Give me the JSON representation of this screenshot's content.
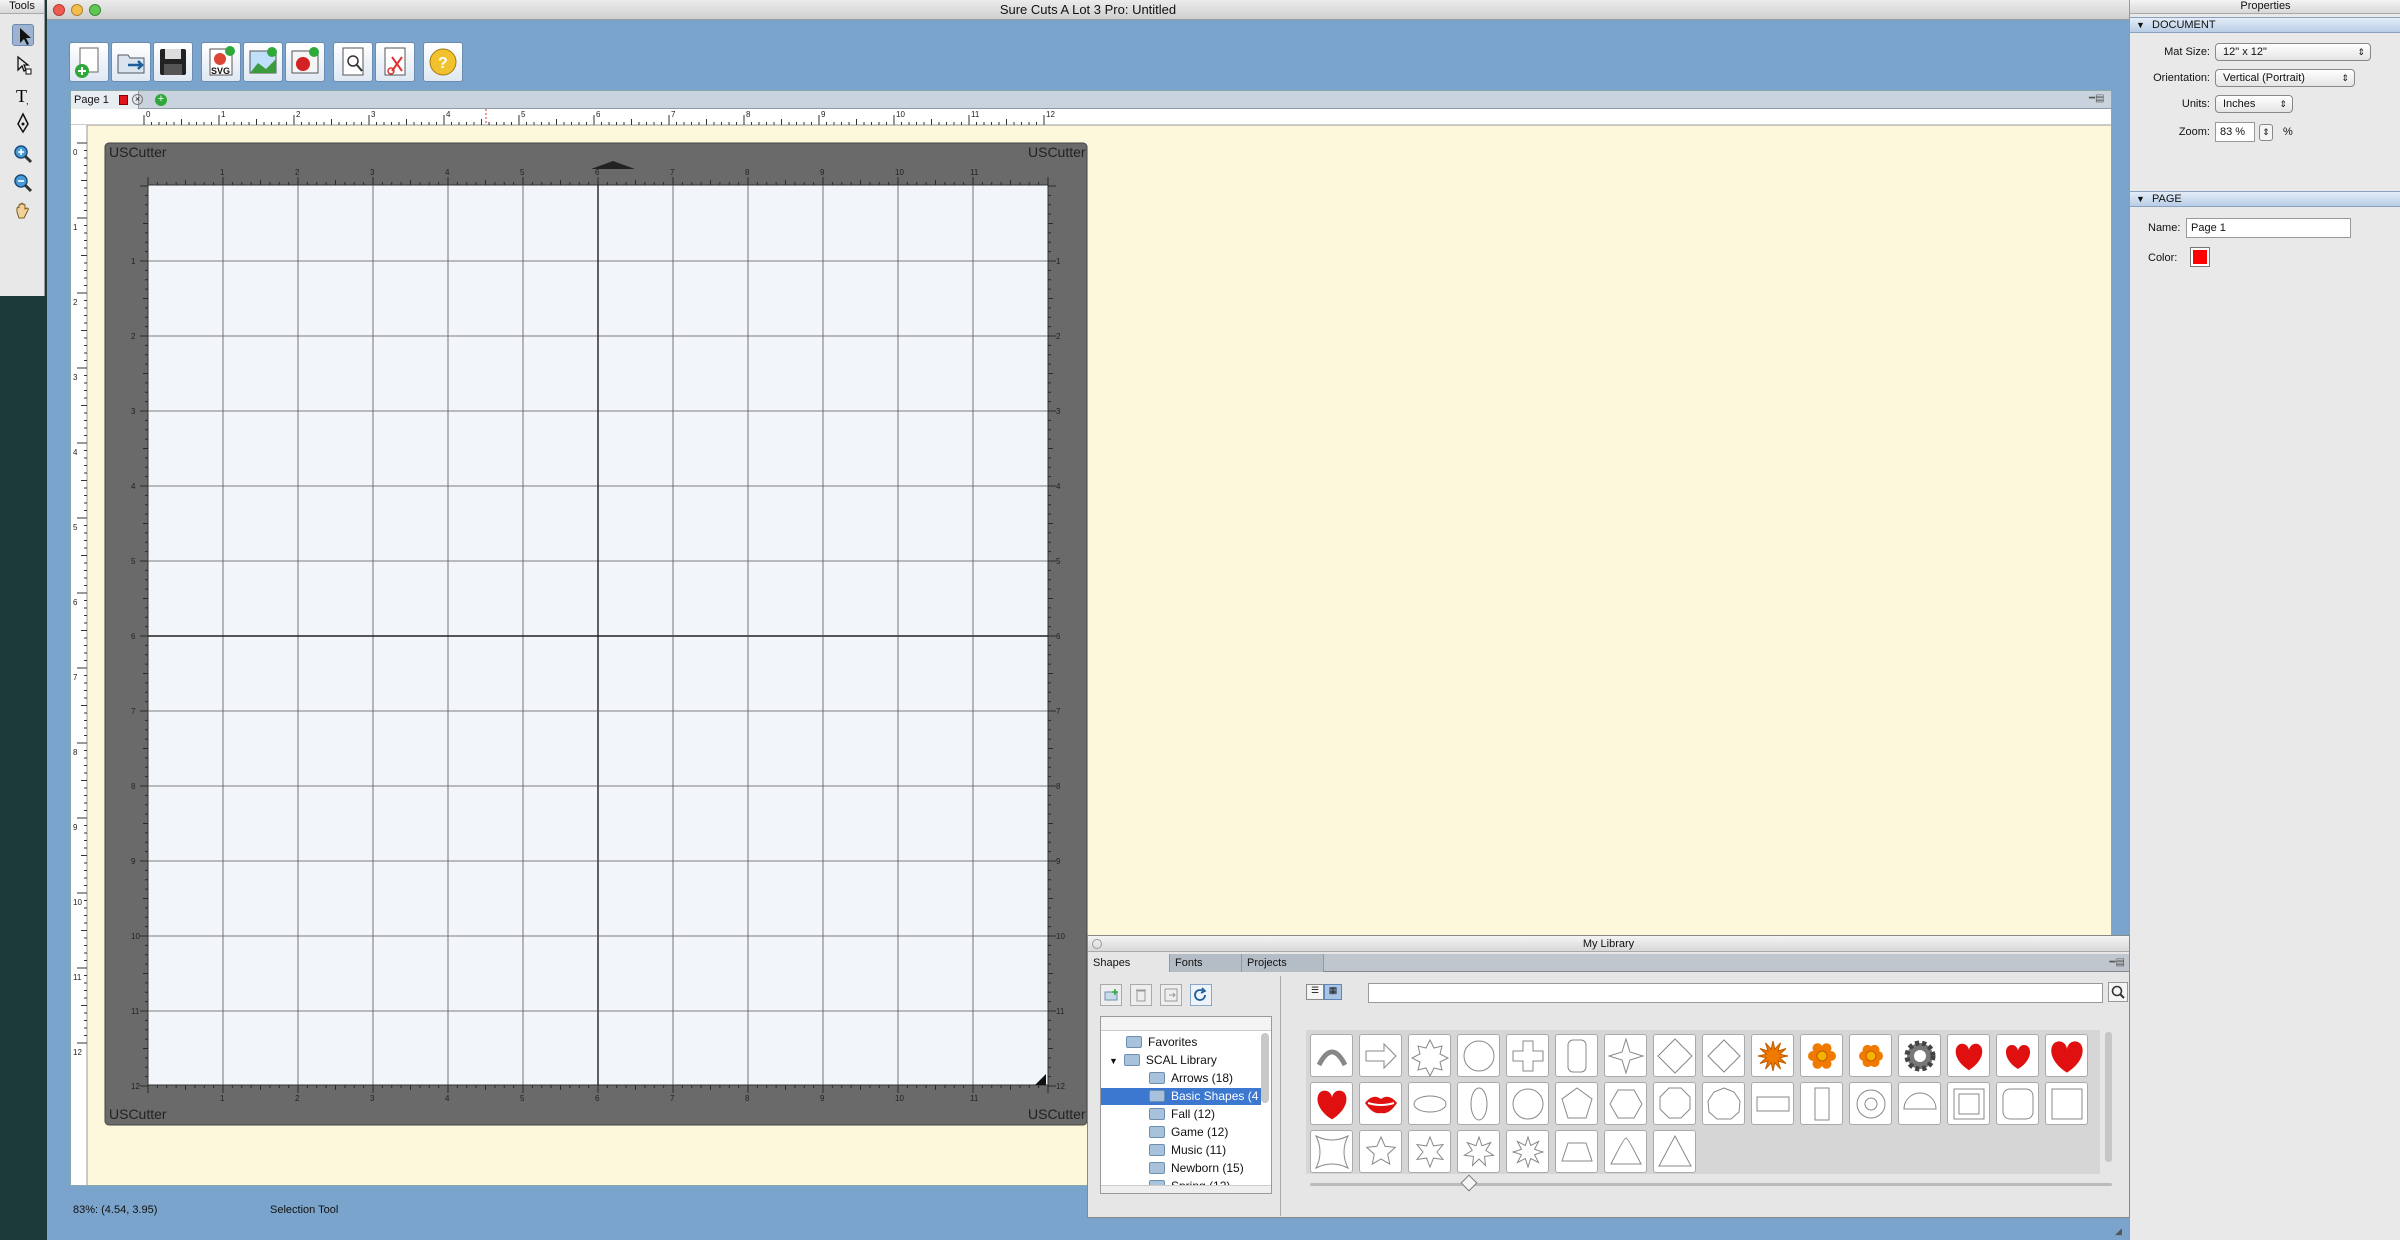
{
  "tools_palette": {
    "title": "Tools",
    "tools": [
      "selection-arrow-icon",
      "node-edit-icon",
      "text-tool-icon",
      "pen-tool-icon",
      "zoom-in-icon",
      "zoom-out-icon",
      "hand-pan-icon"
    ]
  },
  "window": {
    "title": "Sure Cuts A Lot 3 Pro: Untitled"
  },
  "toolbar": {
    "buttons": [
      "new-document-icon",
      "open-icon",
      "save-icon",
      "import-svg-icon",
      "import-image-icon",
      "trace-image-icon",
      "preview-icon",
      "cut-settings-icon",
      "help-icon"
    ]
  },
  "tabs": {
    "page_tab": "Page 1",
    "page_tab_color": "#e0141b"
  },
  "ruler": {
    "ticks": [
      "0",
      "1",
      "2",
      "3",
      "4",
      "5",
      "6",
      "7",
      "8",
      "9",
      "10",
      "11",
      "12"
    ]
  },
  "mat": {
    "brand": "USCutter",
    "inner_ticks": [
      "1",
      "2",
      "3",
      "4",
      "5",
      "6",
      "7",
      "8",
      "9",
      "10",
      "11"
    ],
    "side_ticks": [
      "1",
      "2",
      "3",
      "4",
      "5",
      "6",
      "7",
      "8",
      "9",
      "10",
      "11",
      "12"
    ]
  },
  "status": {
    "zoom_pos": "83%: (4.54, 3.95)",
    "tool": "Selection Tool"
  },
  "properties": {
    "title": "Properties",
    "document_header": "DOCUMENT",
    "mat_size_label": "Mat Size:",
    "mat_size_value": "12\" x 12\"",
    "orientation_label": "Orientation:",
    "orientation_value": "Vertical (Portrait)",
    "units_label": "Units:",
    "units_value": "Inches",
    "zoom_label": "Zoom:",
    "zoom_value": "83 %",
    "zoom_unit": "%",
    "page_header": "PAGE",
    "name_label": "Name:",
    "name_value": "Page 1",
    "color_label": "Color:",
    "color_value": "#ff0000"
  },
  "library": {
    "title": "My Library",
    "tabs": [
      "Shapes",
      "Fonts",
      "Projects"
    ],
    "tree": [
      "Favorites",
      "SCAL Library",
      "Arrows (18)",
      "Basic Shapes (4",
      "Fall (12)",
      "Game (12)",
      "Music (11)",
      "Newborn (15)",
      "Spring (12)"
    ],
    "shape_icons": [
      "arc-shape-icon",
      "arrow-shape-icon",
      "badge-shape-icon",
      "circle-shape-icon",
      "cross-shape-icon",
      "rounded-rect-shape-icon",
      "star4-shape-icon",
      "diamond-shape-icon",
      "diamond-alt-shape-icon",
      "orange-sunflower-icon",
      "orange-flower-icon",
      "orange-flower-small-icon",
      "gear-shape-icon",
      "red-heart-icon",
      "red-heart-small-icon",
      "red-heart-large-icon",
      "red-heart-alt-icon",
      "red-lips-icon",
      "ellipse-shape-icon",
      "vertical-ellipse-shape-icon",
      "circle-alt-shape-icon",
      "pentagon-shape-icon",
      "hexagon-shape-icon",
      "octagon-shape-icon",
      "nonagon-shape-icon",
      "rectangle-shape-icon",
      "vertical-rect-shape-icon",
      "ring-shape-icon",
      "semicircle-shape-icon",
      "square-frame-shape-icon",
      "rounded-square-shape-icon",
      "square-shape-icon",
      "concave-square-shape-icon",
      "star5-shape-icon",
      "star6-shape-icon",
      "star7-shape-icon",
      "star8-shape-icon",
      "trapezoid-shape-icon",
      "triangle-rounded-shape-icon",
      "triangle-shape-icon"
    ]
  }
}
